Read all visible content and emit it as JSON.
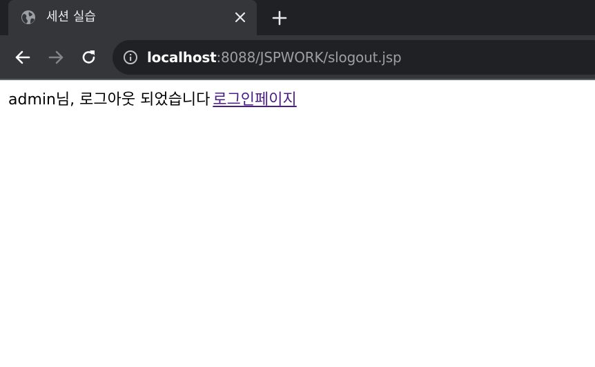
{
  "browser": {
    "tab": {
      "title": "세션 실습",
      "favicon_icon": "globe-icon",
      "close_icon": "close-icon"
    },
    "new_tab_icon": "plus-icon",
    "toolbar": {
      "back_icon": "arrow-left-icon",
      "forward_icon": "arrow-right-icon",
      "reload_icon": "reload-icon",
      "site_info_icon": "info-icon",
      "url_host": "localhost",
      "url_rest": ":8088/JSPWORK/slogout.jsp"
    },
    "colors": {
      "tab_strip": "#202124",
      "toolbar": "#35363a",
      "omnibox": "#202124",
      "link_visited": "#4b1c87"
    }
  },
  "page": {
    "message": "admin님, 로그아웃 되었습니다",
    "link_label": "로그인페이지"
  }
}
